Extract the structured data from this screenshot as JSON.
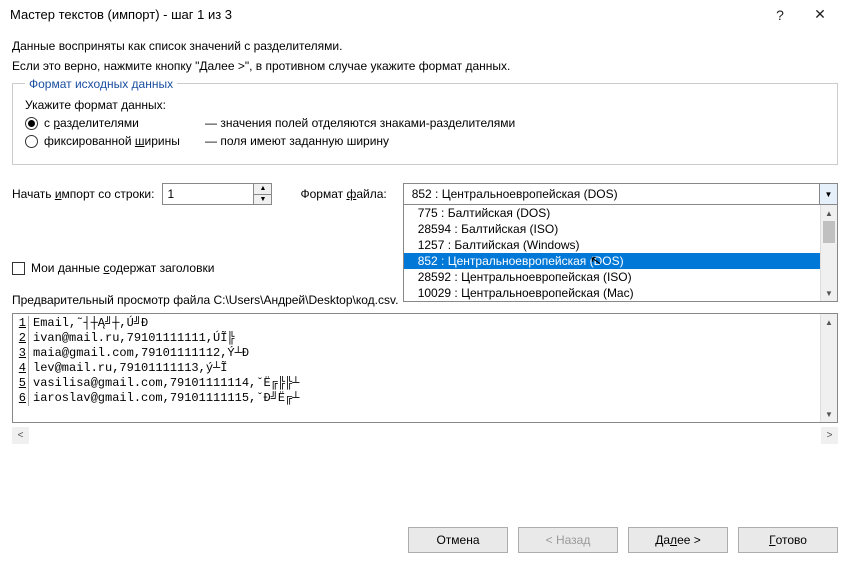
{
  "titlebar": {
    "title": "Мастер текстов (импорт) - шаг 1 из 3",
    "help": "?",
    "close": "✕"
  },
  "instructions": {
    "line1": "Данные восприняты как список значений с разделителями.",
    "line2": "Если это верно, нажмите кнопку \"Далее >\", в противном случае укажите формат данных."
  },
  "format_group": {
    "legend": "Формат исходных данных",
    "prompt": "Укажите формат данных:",
    "delimited": {
      "label_pre": "с ",
      "label_u": "р",
      "label_post": "азделителями",
      "desc": "— значения полей отделяются знаками-разделителями"
    },
    "fixed": {
      "label_pre": "фиксированной ",
      "label_u": "ш",
      "label_post": "ирины",
      "desc": "— поля имеют заданную ширину"
    }
  },
  "start_row": {
    "label_pre": "Начать ",
    "label_u": "и",
    "label_post": "мпорт со строки:",
    "value": "1"
  },
  "file_format": {
    "label_pre": "Формат ",
    "label_u": "ф",
    "label_post": "айла:",
    "selected": "852 : Центральноевропейская (DOS)",
    "options": [
      {
        "text": "775 : Балтийская (DOS)",
        "selected": false
      },
      {
        "text": "28594 : Балтийская (ISO)",
        "selected": false
      },
      {
        "text": "1257 : Балтийская (Windows)",
        "selected": false
      },
      {
        "text": "852 : Центральноевропейская (DOS)",
        "selected": true
      },
      {
        "text": "28592 : Центральноевропейская (ISO)",
        "selected": false
      },
      {
        "text": "10029 : Центральноевропейская (Mac)",
        "selected": false
      }
    ]
  },
  "headers_checkbox": {
    "label_pre": "Мои данные ",
    "label_u": "с",
    "label_post": "одержат заголовки"
  },
  "preview": {
    "label": "Предварительный просмотр файла C:\\Users\\Андрей\\Desktop\\код.csv.",
    "lines": [
      "Email,˜┤┼Ą╝┼,Ú╝Đ",
      "ivan@mail.ru,79101111111,ÚĨ╠",
      "maia@gmail.com,79101111112,Ý┴Đ",
      "lev@mail.ru,79101111113,ý┴Ĩ",
      "vasilisa@gmail.com,79101111114,ˇË╔╠╠┴",
      "iaroslav@gmail.com,79101111115,ˇĐ╝Ë╔┴"
    ]
  },
  "buttons": {
    "cancel": "Отмена",
    "back": "< Назад",
    "next_pre": "Да",
    "next_u": "л",
    "next_post": "ее >",
    "finish_pre": "",
    "finish_u": "Г",
    "finish_post": "отово"
  }
}
